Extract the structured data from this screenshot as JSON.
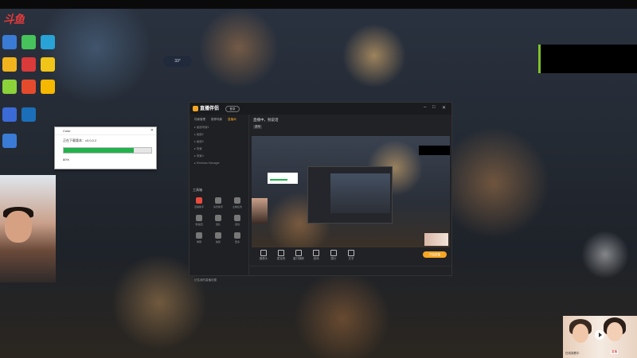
{
  "desktop": {
    "logo_text": "斗鱼",
    "icons": [
      {
        "name": "app-icon-1",
        "label": "",
        "color": "#3a7bd5"
      },
      {
        "name": "app-icon-2",
        "label": "",
        "color": "#46c35a"
      },
      {
        "name": "app-icon-3",
        "label": "",
        "color": "#29a3d6"
      },
      {
        "name": "app-icon-4",
        "label": "",
        "color": "#f2b41d"
      },
      {
        "name": "app-icon-5",
        "label": "",
        "color": "#d93a3a"
      },
      {
        "name": "app-icon-6",
        "label": "",
        "color": "#f0c419"
      },
      {
        "name": "app-icon-7",
        "label": "",
        "color": "#8bd13a"
      },
      {
        "name": "app-icon-8",
        "label": "",
        "color": "#e44b2c"
      },
      {
        "name": "app-icon-9",
        "label": "",
        "color": "#f5b700"
      },
      {
        "name": "app-icon-10",
        "label": "",
        "color": "#3b6bd6"
      },
      {
        "name": "app-icon-11",
        "label": "",
        "color": "#1b6fb8"
      },
      {
        "name": "app-icon-12",
        "label": "",
        "color": "#3a7bd5"
      }
    ],
    "temp_badge": "33°"
  },
  "download_dialog": {
    "title": "Color",
    "status": "正在下载版本：v3.0.0.2",
    "percent_text": "80%",
    "progress": 0.8,
    "progress_color": "#22b14c"
  },
  "stream_app": {
    "name": "直播伴侣",
    "pill": "登录",
    "tabs": [
      "场景管理",
      "推荐场景",
      "直播间"
    ],
    "active_tab": 2,
    "scenes": [
      "画面场景1",
      "画面2",
      "画面3",
      "场景",
      "场景4",
      "Windows Manager"
    ],
    "tools_label": "工具箱",
    "tools": [
      {
        "label": "直播助手",
        "color": "#e94b3c"
      },
      {
        "label": "房管助手",
        "color": "#777"
      },
      {
        "label": "主播任务",
        "color": "#777"
      },
      {
        "label": "粉丝团",
        "color": "#777"
      },
      {
        "label": "送礼",
        "color": "#777"
      },
      {
        "label": "连线",
        "color": "#777"
      },
      {
        "label": "弹幕",
        "color": "#777"
      },
      {
        "label": "抽奖",
        "color": "#777"
      },
      {
        "label": "更多",
        "color": "#777"
      }
    ],
    "live_title": "直播中，别说话",
    "live_tag": "游戏",
    "bottom_buttons": [
      "摄像头",
      "麦克风",
      "窗口捕获",
      "游戏",
      "图片",
      "文字"
    ],
    "start_label": "开始直播",
    "remember_label": "记住我的直播设置"
  },
  "pip_overlay": {
    "text": "在线观看中",
    "tag": "直播"
  }
}
